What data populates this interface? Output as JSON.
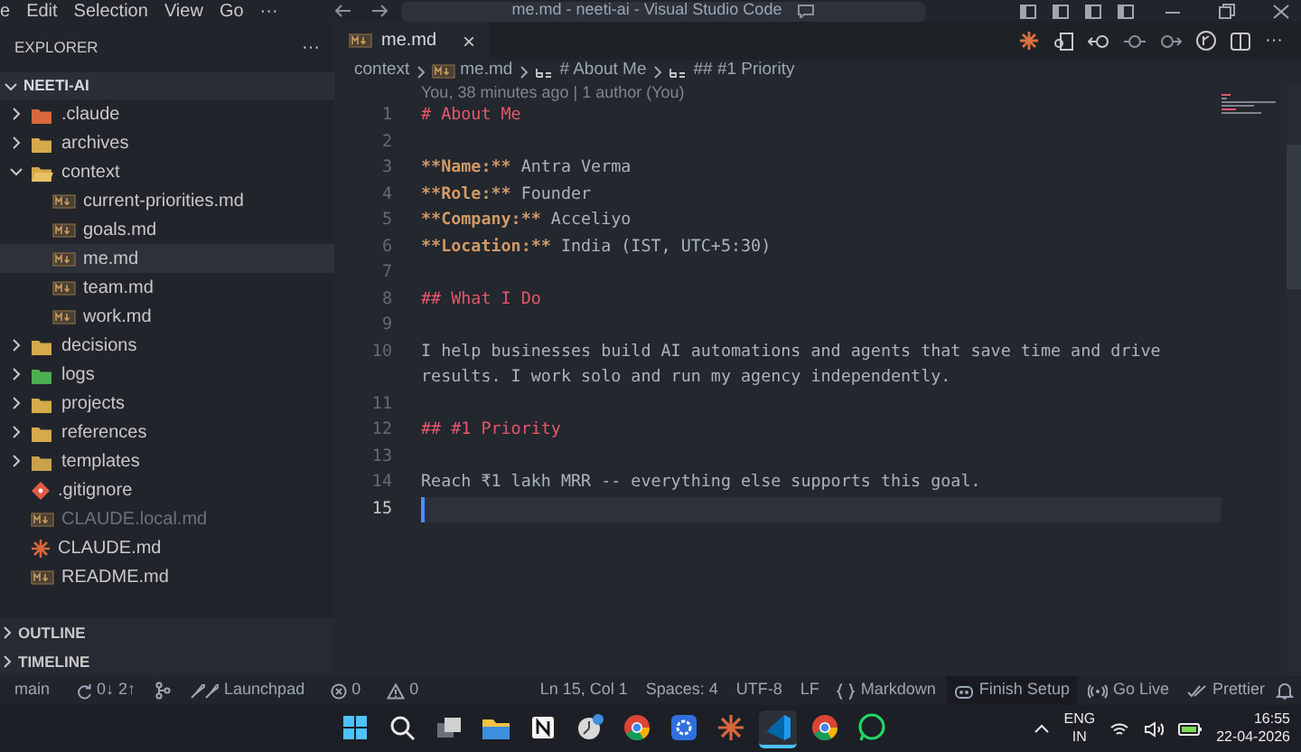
{
  "menu": [
    "e",
    "Edit",
    "Selection",
    "View",
    "Go",
    "···"
  ],
  "title": "me.md - neeti-ai - Visual Studio Code",
  "sidebar": {
    "header": "EXPLORER",
    "more": "···",
    "root": {
      "label": "NEETI-AI",
      "expanded": true,
      "children": [
        {
          "label": ".claude",
          "kind": "claude-folder",
          "expanded": false,
          "selected": false,
          "ignored": false
        },
        {
          "label": "archives",
          "kind": "folder",
          "expanded": false,
          "selected": false,
          "ignored": false
        },
        {
          "label": "context",
          "kind": "folder",
          "expanded": true,
          "selected": false,
          "ignored": false,
          "children": [
            {
              "label": "current-priorities.md",
              "kind": "md-file",
              "selected": false,
              "ignored": false
            },
            {
              "label": "goals.md",
              "kind": "md-file",
              "selected": false,
              "ignored": false
            },
            {
              "label": "me.md",
              "kind": "md-file",
              "selected": true,
              "ignored": false
            },
            {
              "label": "team.md",
              "kind": "md-file",
              "selected": false,
              "ignored": false
            },
            {
              "label": "work.md",
              "kind": "md-file",
              "selected": false,
              "ignored": false
            }
          ]
        },
        {
          "label": "decisions",
          "kind": "folder",
          "expanded": false,
          "selected": false,
          "ignored": false
        },
        {
          "label": "logs",
          "kind": "logs-folder",
          "expanded": false,
          "selected": false,
          "ignored": false
        },
        {
          "label": "projects",
          "kind": "folder",
          "expanded": false,
          "selected": false,
          "ignored": false
        },
        {
          "label": "references",
          "kind": "folder",
          "expanded": false,
          "selected": false,
          "ignored": false
        },
        {
          "label": "templates",
          "kind": "templates-folder",
          "expanded": false,
          "selected": false,
          "ignored": false
        },
        {
          "label": ".gitignore",
          "kind": "git-file",
          "selected": false,
          "ignored": false
        },
        {
          "label": "CLAUDE.local.md",
          "kind": "md-file",
          "selected": false,
          "ignored": true
        },
        {
          "label": "CLAUDE.md",
          "kind": "claude-file",
          "selected": false,
          "ignored": false
        },
        {
          "label": "README.md",
          "kind": "md-file",
          "selected": false,
          "ignored": false
        }
      ]
    },
    "sections": [
      "OUTLINE",
      "TIMELINE"
    ]
  },
  "tab": {
    "label": "me.md",
    "close": "×"
  },
  "breadcrumbs": [
    {
      "label": "context",
      "kind": "folder"
    },
    {
      "label": "me.md",
      "kind": "md"
    },
    {
      "label": "# About Me",
      "kind": "symbol"
    },
    {
      "label": "## #1 Priority",
      "kind": "symbol"
    }
  ],
  "blame": "You, 38 minutes ago | 1 author (You)",
  "lines": [
    {
      "number": "1",
      "active": false,
      "segments": [
        {
          "kind": "heading",
          "text": "# About Me"
        }
      ]
    },
    {
      "number": "2",
      "active": false
    },
    {
      "number": "3",
      "active": false,
      "segments": [
        {
          "kind": "bold",
          "text": "**Name:**"
        },
        {
          "kind": "text",
          "text": " Antra Verma"
        }
      ]
    },
    {
      "number": "4",
      "active": false,
      "segments": [
        {
          "kind": "bold",
          "text": "**Role:**"
        },
        {
          "kind": "text",
          "text": " Founder"
        }
      ]
    },
    {
      "number": "5",
      "active": false,
      "segments": [
        {
          "kind": "bold",
          "text": "**Company:**"
        },
        {
          "kind": "text",
          "text": " Acceliyo"
        }
      ]
    },
    {
      "number": "6",
      "active": false,
      "segments": [
        {
          "kind": "bold",
          "text": "**Location:**"
        },
        {
          "kind": "text",
          "text": " India (IST, UTC+5:30)"
        }
      ]
    },
    {
      "number": "7",
      "active": false
    },
    {
      "number": "8",
      "active": false,
      "segments": [
        {
          "kind": "heading",
          "text": "## What I Do"
        }
      ]
    },
    {
      "number": "9",
      "active": false
    },
    {
      "number": "10",
      "active": false,
      "segments": [
        {
          "kind": "text",
          "text": "I help businesses build AI automations and agents that save time and drive results. I work solo and run my agency independently."
        }
      ]
    },
    {
      "number": "11",
      "active": false
    },
    {
      "number": "12",
      "active": false,
      "segments": [
        {
          "kind": "heading",
          "text": "## #1 Priority"
        }
      ]
    },
    {
      "number": "13",
      "active": false
    },
    {
      "number": "14",
      "active": false,
      "segments": [
        {
          "kind": "text",
          "text": "Reach ₹1 lakh MRR -- everything else supports this goal."
        }
      ]
    },
    {
      "number": "15",
      "active": true
    }
  ],
  "status_bar": {
    "left": [
      {
        "kind": "text",
        "text": "main"
      },
      {
        "kind": "sync",
        "text": "0↓ 2↑"
      },
      {
        "kind": "graph"
      },
      {
        "kind": "launchpad",
        "text": "Launchpad"
      },
      {
        "kind": "errors",
        "text": "0"
      },
      {
        "kind": "warnings",
        "text": "0"
      }
    ],
    "right": [
      {
        "kind": "text",
        "text": "Ln 15, Col 1"
      },
      {
        "kind": "text",
        "text": "Spaces: 4"
      },
      {
        "kind": "text",
        "text": "UTF-8"
      },
      {
        "kind": "text",
        "text": "LF"
      },
      {
        "kind": "braces",
        "text": "Markdown"
      },
      {
        "kind": "setup",
        "text": "Finish Setup"
      },
      {
        "kind": "live",
        "text": "Go Live"
      },
      {
        "kind": "check",
        "text": "Prettier"
      },
      {
        "kind": "bell"
      }
    ]
  },
  "taskbar": {
    "apps": [
      {
        "kind": "windows",
        "active": false
      },
      {
        "kind": "search",
        "active": false
      },
      {
        "kind": "taskview",
        "active": false
      },
      {
        "kind": "files",
        "active": false
      },
      {
        "kind": "notion",
        "active": false
      },
      {
        "kind": "badge-app",
        "active": false
      },
      {
        "kind": "chrome",
        "active": false
      },
      {
        "kind": "gear",
        "active": false
      },
      {
        "kind": "claude",
        "active": false
      },
      {
        "kind": "vscode",
        "active": true
      },
      {
        "kind": "chrome",
        "active": false
      },
      {
        "kind": "whatsapp",
        "active": false
      }
    ],
    "language": "ENG",
    "region": "IN",
    "time": "16:55",
    "date": "22-04-2026"
  }
}
